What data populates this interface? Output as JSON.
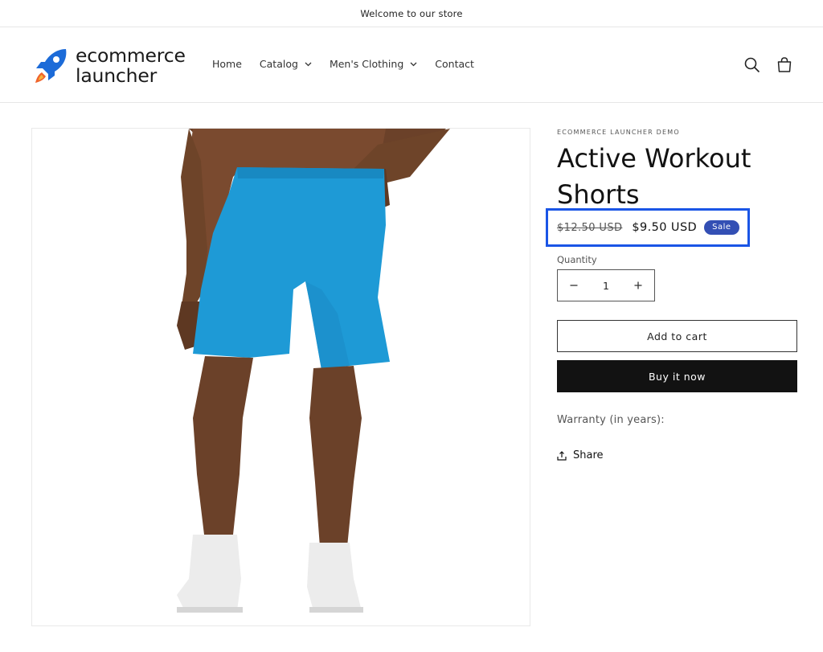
{
  "announcement": "Welcome to our store",
  "logo": {
    "line1": "ecommerce",
    "line2": "launcher"
  },
  "nav": {
    "home": "Home",
    "catalog": "Catalog",
    "mens_clothing": "Men's Clothing",
    "contact": "Contact"
  },
  "header_icons": [
    "search-icon",
    "cart-icon"
  ],
  "product": {
    "vendor": "ECOMMERCE LAUNCHER DEMO",
    "title_line1": "Active Workout",
    "title_line2": "Shorts",
    "old_price": "$12.50 USD",
    "new_price": "$9.50 USD",
    "badge": "Sale",
    "quantity_label": "Quantity",
    "quantity": "1",
    "add_to_cart": "Add to cart",
    "buy_now": "Buy it now",
    "warranty": "Warranty (in years):",
    "share": "Share"
  },
  "colors": {
    "highlight_border": "#1a55e6",
    "sale_badge": "#334fb4",
    "buy_button": "#121212",
    "shorts": "#1e9ad6"
  }
}
